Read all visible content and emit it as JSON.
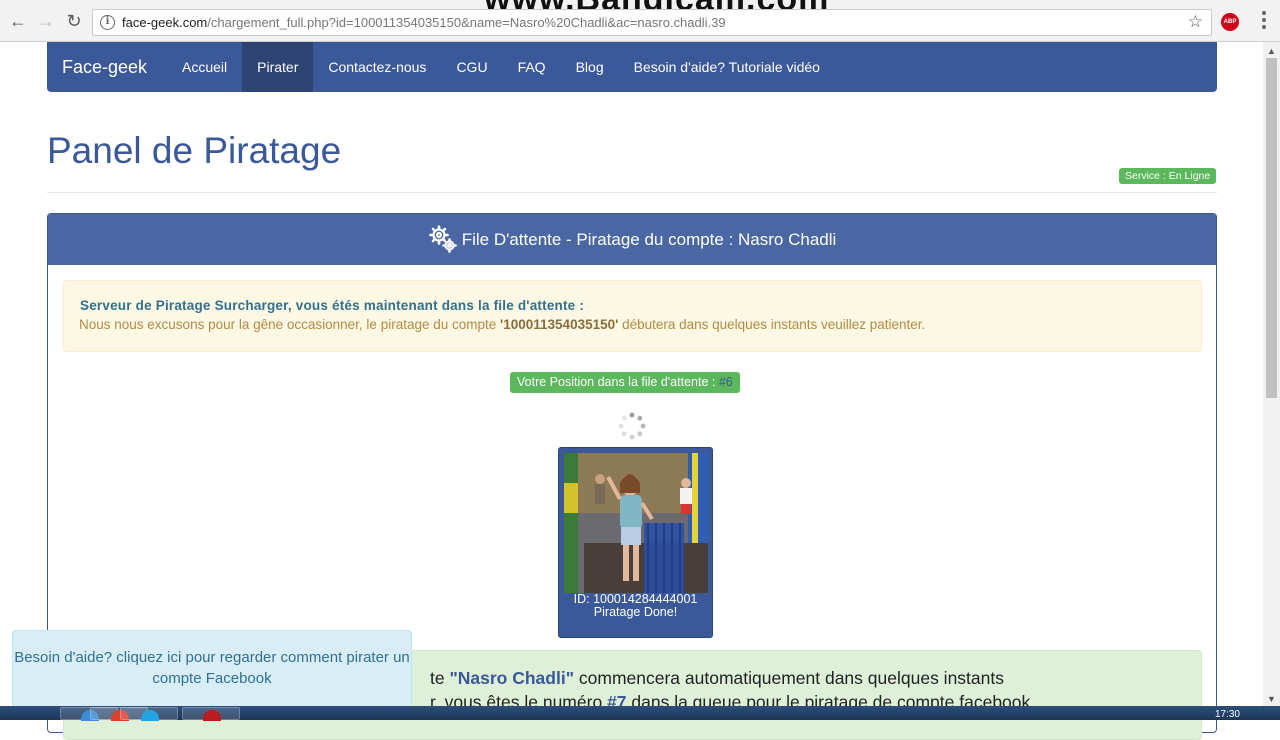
{
  "browser": {
    "url_host": "face-geek.com",
    "url_path": "/chargement_full.php?id=100011354035150&name=Nasro%20Chadli&ac=nasro.chadli.39",
    "watermark": "www.Bandicam.com",
    "adblock_label": "ABP"
  },
  "navbar": {
    "brand": "Face-geek",
    "links": [
      {
        "label": "Accueil"
      },
      {
        "label": "Pirater"
      },
      {
        "label": "Contactez-nous"
      },
      {
        "label": "CGU"
      },
      {
        "label": "FAQ"
      },
      {
        "label": "Blog"
      },
      {
        "label": "Besoin d'aide? Tutoriale vidéo"
      }
    ],
    "active_index": 1,
    "color": "#3b5998"
  },
  "header": {
    "title": "Panel de Piratage",
    "service_badge": "Service : En Ligne"
  },
  "panel": {
    "heading": "File D'attente - Piratage du compte : Nasro Chadli",
    "warning": {
      "line1": "Serveur de Piratage Surcharger, vous étés maintenant dans la file d'attente :",
      "line2_prefix": "Nous nous excusons pour la gêne occasionner, le piratage du compte ",
      "line2_account": "'100011354035150'",
      "line2_suffix": " débutera dans quelques instants veuillez patienter."
    },
    "position": {
      "label": "Votre Position dans la file d'attente : ",
      "value": "#6"
    },
    "profile": {
      "id_text": "ID: 100014284444001",
      "status_text": "Piratage Done!"
    },
    "success": {
      "t1_prefix": "te ",
      "t1_name": "\"Nasro Chadli\"",
      "t1_suffix": " commencera automatiquement dans quelques instants",
      "t2_prefix": "r, vous êtes le numéro ",
      "t2_num": "#7",
      "t2_suffix": " dans la queue pour le piratage de compte facebook"
    }
  },
  "help_popup": {
    "text": "Besoin d'aide? cliquez ici pour regarder comment pirater un compte Facebook"
  },
  "taskbar": {
    "clock": "17:30"
  }
}
